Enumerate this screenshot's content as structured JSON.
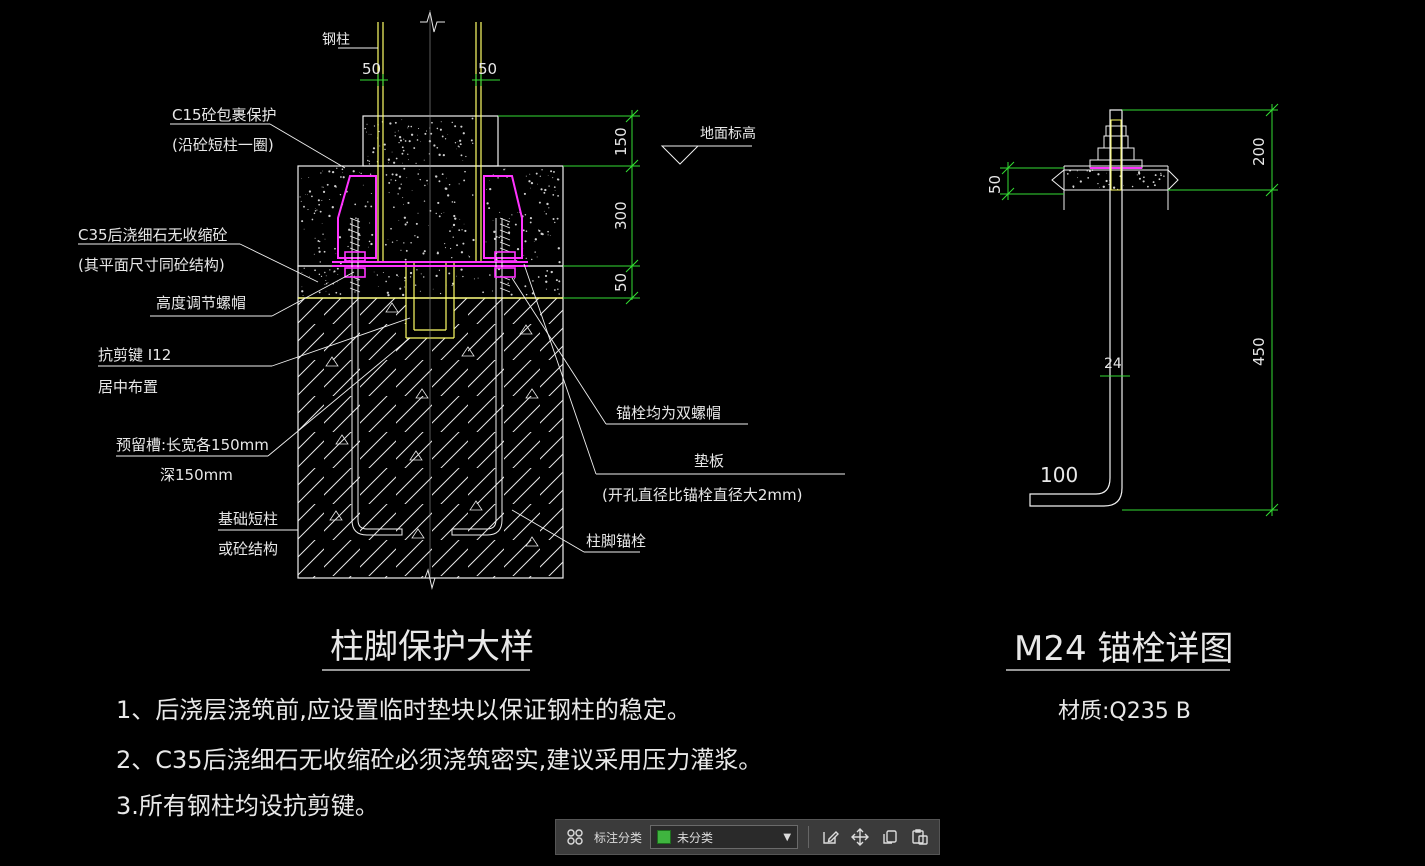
{
  "colors": {
    "background": "#000000",
    "outline": "#f0f0f0",
    "pink": "#ff33ff",
    "yellow": "#ffff66",
    "green": "#33dd33",
    "text": "#e8e8e8"
  },
  "left_detail": {
    "labels": {
      "steel_column": "钢柱",
      "c15_line1": "C15砼包裹保护",
      "c15_line2": "(沿砼短柱一圈)",
      "c35_line1": "C35后浇细石无收缩砼",
      "c35_line2": "(其平面尺寸同砼结构)",
      "leveling_nut": "高度调节螺帽",
      "shear_key_line1": "抗剪键 I12",
      "shear_key_line2": "居中布置",
      "groove_line1": "预留槽:长宽各150mm",
      "groove_line2": "深150mm",
      "foundation_line1": "基础短柱",
      "foundation_line2": "或砼结构",
      "ground_level": "地面标高",
      "double_nut": "锚栓均为双螺帽",
      "plate_line1": "垫板",
      "plate_line2": "(开孔直径比锚栓直径大2mm)",
      "anchor": "柱脚锚栓"
    },
    "dims": {
      "left_50": "50",
      "right_50": "50",
      "d150": "150",
      "d300": "300",
      "d50": "50"
    },
    "title": "柱脚保护大样"
  },
  "right_detail": {
    "dims": {
      "d50": "50",
      "d200": "200",
      "d450": "450",
      "d24": "24",
      "d100": "100"
    },
    "title": "M24 锚栓详图",
    "material": "材质:Q235 B"
  },
  "notes": [
    "1、后浇层浇筑前,应设置临时垫块以保证钢柱的稳定。",
    "2、C35后浇细石无收缩砼必须浇筑密实,建议采用压力灌浆。",
    "3.所有钢柱均设抗剪键。"
  ],
  "toolbar": {
    "label": "标注分类",
    "selected": "未分类"
  }
}
